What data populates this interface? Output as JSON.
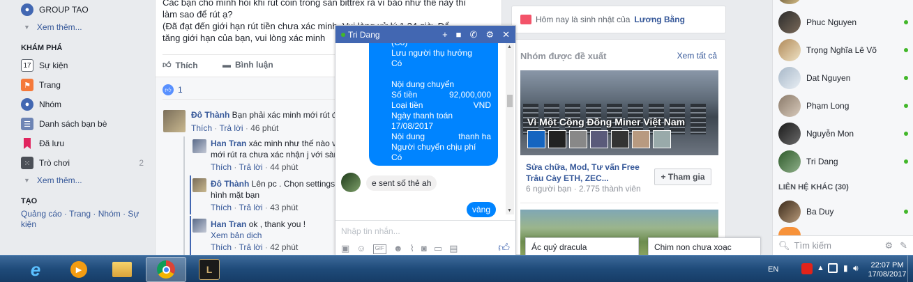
{
  "sidebar": {
    "group_label": "GROUP TAO",
    "see_more_1": "Xem thêm...",
    "explore_header": "KHÁM PHÁ",
    "items": [
      {
        "label": "Sự kiện",
        "icon": "calendar-icon",
        "count": ""
      },
      {
        "label": "Trang",
        "icon": "flag-icon",
        "count": ""
      },
      {
        "label": "Nhóm",
        "icon": "groups-icon",
        "count": ""
      },
      {
        "label": "Danh sách bạn bè",
        "icon": "friend-list-icon",
        "count": ""
      },
      {
        "label": "Đã lưu",
        "icon": "bookmark-icon",
        "count": ""
      },
      {
        "label": "Trò chơi",
        "icon": "games-icon",
        "count": "2"
      }
    ],
    "calendar_day": "17",
    "see_more_2": "Xem thêm...",
    "create_header": "TẠO",
    "create_links": "Quảng cáo · Trang · Nhóm · Sự kiện"
  },
  "post": {
    "text_line1": "Các bạn cho mình hỏi khi rút coin trong sàn bittrex rà vì bảo như thế này thì",
    "text_line2": "làm sao để rút ạ?",
    "text_line3": "(Đã đạt đến giới hạn rút tiền chưa xác minh. Vui lòng xử lý 1 24 giờ. Để",
    "text_line4": "tăng giới hạn của bạn, vui lòng xác minh",
    "like_label": "Thích",
    "comment_label": "Bình luận",
    "reaction_count": "1"
  },
  "comments": [
    {
      "author": "Đô Thành",
      "text": "Bạn phải xác minh mới rút được",
      "text2": "",
      "like": "Thích",
      "reply": "Trả lời",
      "time": "46 phút"
    },
    {
      "author": "Han Tran",
      "text": "xác minh như thế nào v",
      "text2": "mới rút ra chưa xác nhận j với sàn",
      "like": "Thích",
      "reply": "Trả lời",
      "time": "44 phút"
    },
    {
      "author": "Đô Thành",
      "text": "Lên pc . Chọn settings",
      "text2": "hình mặt bạn",
      "like": "Thích",
      "reply": "Trả lời",
      "time": "43 phút"
    },
    {
      "author": "Han Tran",
      "text": "ok , thank you !",
      "text2": "Xem bản dịch",
      "like": "Thích",
      "reply": "Trả lời",
      "time": "42 phút"
    }
  ],
  "chat": {
    "name": "Tri Dang",
    "big_message": {
      "lines": [
        {
          "k": "(Có)",
          "v": ""
        },
        {
          "k": "Lưu người thụ hưởng",
          "v": ""
        },
        {
          "k": "Có",
          "v": ""
        },
        {
          "k": "",
          "v": ""
        },
        {
          "k": "Nội dung chuyển",
          "v": ""
        },
        {
          "k": "Số tiền",
          "v": "92,000,000"
        },
        {
          "k": "Loại tiền",
          "v": "VND"
        },
        {
          "k": "Ngày thanh toán",
          "v": ""
        },
        {
          "k": "17/08/2017",
          "v": ""
        },
        {
          "k": "Nội dung",
          "v": "thanh ha"
        },
        {
          "k": "Người chuyển chịu phí",
          "v": ""
        },
        {
          "k": "Có",
          "v": ""
        }
      ]
    },
    "incoming": "e sent số thẻ ah",
    "outgoing": "vâng",
    "placeholder": "Nhập tin nhắn..."
  },
  "right": {
    "birthday_prefix": "Hôm nay là sinh nhật của",
    "birthday_name": "Lương Bằng",
    "groups_title": "Nhóm được đề xuất",
    "see_all": "Xem tất cả",
    "banner_text": "Vì Một Cộng Đồng Miner Việt Nam",
    "group_name_1": "Sửa chữa, Mod, Tư vấn Free",
    "group_name_2": "Trâu Cày ETH, ZEC...",
    "group_meta": "6 người bạn · 2.775 thành viên",
    "join_label": "+ Tham gia"
  },
  "contacts": {
    "online": [
      {
        "name": "Phuc Nguyen"
      },
      {
        "name": "Trọng Nghĩa Lê Võ"
      },
      {
        "name": "Dat Nguyen"
      },
      {
        "name": "Phạm Long"
      },
      {
        "name": "Nguyễn Mon"
      },
      {
        "name": "Tri Dang"
      }
    ],
    "other_header": "LIÊN HỆ KHÁC (30)",
    "other": [
      {
        "name": "Ba Duy"
      }
    ],
    "search_placeholder": "Tìm kiếm"
  },
  "minimized_chats": [
    "Ác quỷ dracula",
    "Chim non chưa xoạc"
  ],
  "taskbar": {
    "lang": "EN",
    "time": "22:07 PM",
    "date": "17/08/2017"
  }
}
